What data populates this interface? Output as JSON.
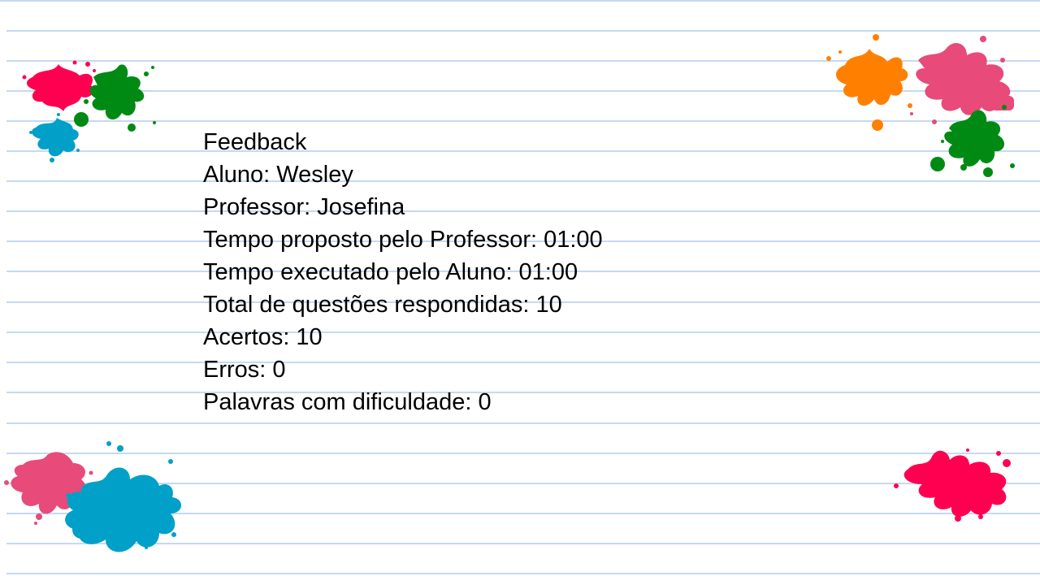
{
  "feedback": {
    "title": "Feedback",
    "student": "Aluno: Wesley",
    "teacher": "Professor: Josefina",
    "time_proposed": "Tempo proposto pelo Professor: 01:00",
    "time_executed": "Tempo executado pelo Aluno: 01:00",
    "total_answered": "Total de questões respondidas: 10",
    "correct": "Acertos: 10",
    "errors": "Erros: 0",
    "difficult_words": "Palavras com dificuldade: 0"
  },
  "colors": {
    "ruled_line": "#c6d9f1",
    "splat_pink": "#e84a7a",
    "splat_red": "#ff0050",
    "splat_green": "#008a14",
    "splat_blue": "#00a0c8",
    "splat_orange": "#ff8000"
  },
  "decorations": {
    "background": "ruled-notebook-paper",
    "splats": [
      "paint-splat-top-left",
      "paint-splat-top-right",
      "paint-splat-bottom-left",
      "paint-splat-bottom-right"
    ]
  }
}
